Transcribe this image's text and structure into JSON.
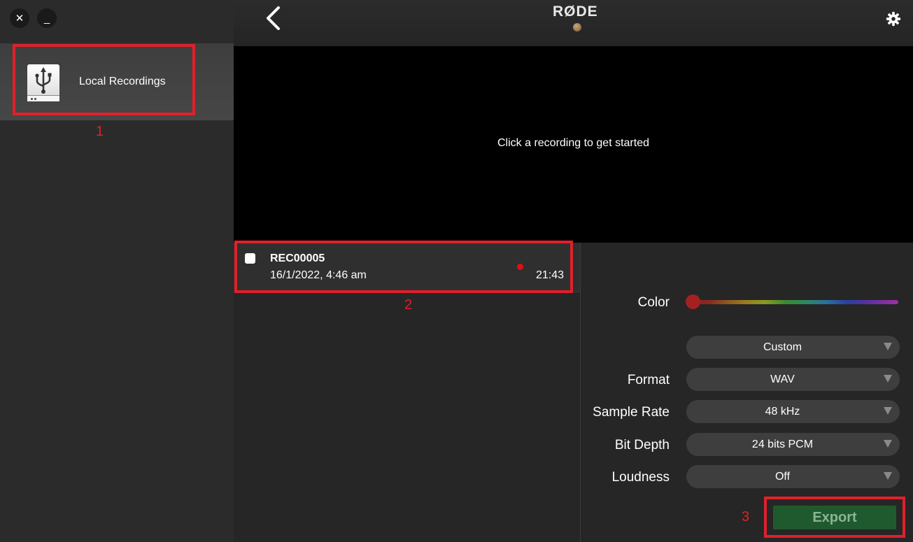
{
  "window": {
    "close_label": "✕",
    "minimize_label": "_"
  },
  "sidebar": {
    "source_label": "Local Recordings"
  },
  "header": {
    "logo": "RØDE"
  },
  "preview": {
    "message": "Click a recording to get started"
  },
  "recording": {
    "name": "REC00005",
    "date": "16/1/2022, 4:46 am",
    "duration": "21:43"
  },
  "panel": {
    "color_label": "Color",
    "preset_value": "Custom",
    "format_label": "Format",
    "format_value": "WAV",
    "sample_rate_label": "Sample Rate",
    "sample_rate_value": "48 kHz",
    "bit_depth_label": "Bit Depth",
    "bit_depth_value": "24 bits PCM",
    "loudness_label": "Loudness",
    "loudness_value": "Off",
    "export_label": "Export"
  },
  "annotations": {
    "one": "1",
    "two": "2",
    "three": "3"
  },
  "colors": {
    "accent_red": "#e0202a",
    "export_green": "#1f5a2e",
    "record_dot": "#e01010"
  }
}
